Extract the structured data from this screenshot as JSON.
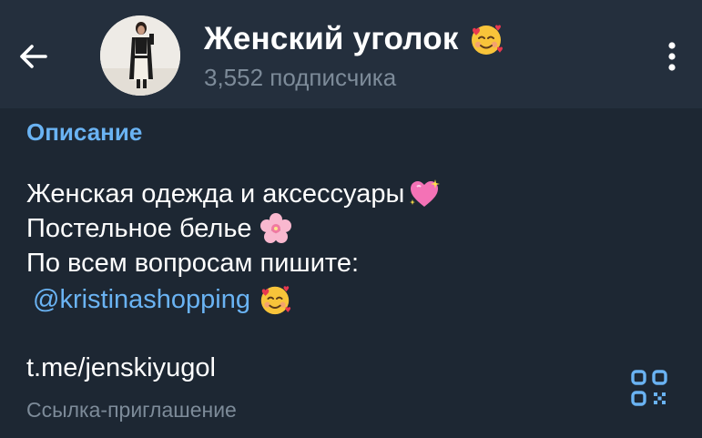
{
  "header": {
    "back_icon": "arrow-left-icon",
    "channel_name": "Женский уголок",
    "title_emoji": "smiling-face-with-hearts-emoji",
    "subscribers": "3,552 подписчика",
    "menu_icon": "more-vertical-icon"
  },
  "description": {
    "section_title": "Описание",
    "lines": [
      {
        "text": "Женская одежда и аксессуары",
        "emoji": "sparkling-heart-emoji"
      },
      {
        "text": "Постельное белье",
        "emoji": "cherry-blossom-emoji"
      },
      {
        "text": "По всем вопросам пишите:",
        "emoji": ""
      },
      {
        "text": "@kristinashopping",
        "emoji": "smiling-face-with-hearts-emoji"
      }
    ]
  },
  "invite": {
    "link": "t.me/jenskiyugol",
    "caption": "Ссылка-приглашение",
    "qr_icon": "qr-code-icon"
  },
  "colors": {
    "background": "#1d2733",
    "header": "#242f3d",
    "accent": "#6ab3f3",
    "secondary_text": "#7d8b99"
  }
}
